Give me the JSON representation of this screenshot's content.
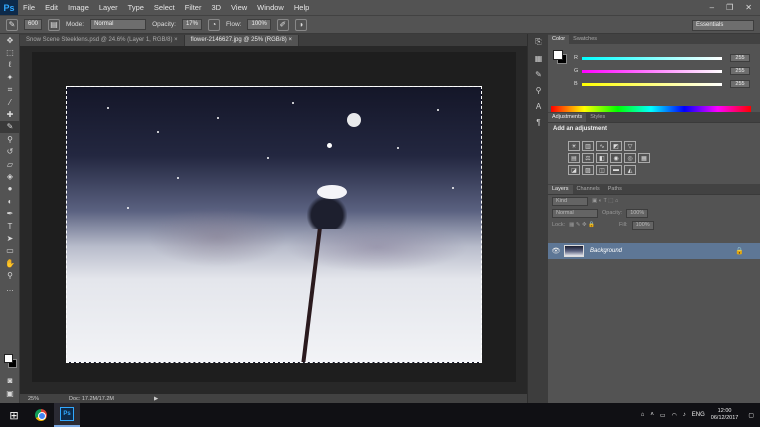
{
  "app": {
    "logo": "Ps"
  },
  "menu": [
    "File",
    "Edit",
    "Image",
    "Layer",
    "Type",
    "Select",
    "Filter",
    "3D",
    "View",
    "Window",
    "Help"
  ],
  "window_controls": [
    "–",
    "❐",
    "✕"
  ],
  "options": {
    "brush_size": "600",
    "mode_label": "Mode:",
    "mode_value": "Normal",
    "opacity_label": "Opacity:",
    "opacity_value": "17%",
    "flow_label": "Flow:",
    "flow_value": "100%",
    "workspace": "Essentials"
  },
  "tabs": [
    {
      "label": "Snow Scene Steeklens.psd @ 24.6% (Layer 1, RGB/8) ×",
      "active": false
    },
    {
      "label": "flower-2146627.jpg @ 25% (RGB/8) ×",
      "active": true
    }
  ],
  "status": {
    "zoom": "25%",
    "doc": "Doc: 17.2M/17.2M"
  },
  "color_panel": {
    "tabs": [
      "Color",
      "Swatches"
    ],
    "channels": [
      {
        "letter": "R",
        "value": "255"
      },
      {
        "letter": "G",
        "value": "255"
      },
      {
        "letter": "B",
        "value": "255"
      }
    ]
  },
  "adjustments": {
    "tabs": [
      "Adjustments",
      "Styles"
    ],
    "title": "Add an adjustment"
  },
  "layers": {
    "tabs": [
      "Layers",
      "Channels",
      "Paths"
    ],
    "kind": "Kind",
    "blend": "Normal",
    "opacity_label": "Opacity:",
    "opacity_value": "100%",
    "lock_label": "Lock:",
    "fill_label": "Fill:",
    "fill_value": "100%",
    "layer_name": "Background"
  },
  "taskbar": {
    "lang": "ENG",
    "time": "12:00",
    "date": "06/12/2017",
    "ps_label": "Ps"
  },
  "colors": {
    "accent": "#5e7796",
    "ui_bg": "#535353",
    "dark_bg": "#282828"
  }
}
